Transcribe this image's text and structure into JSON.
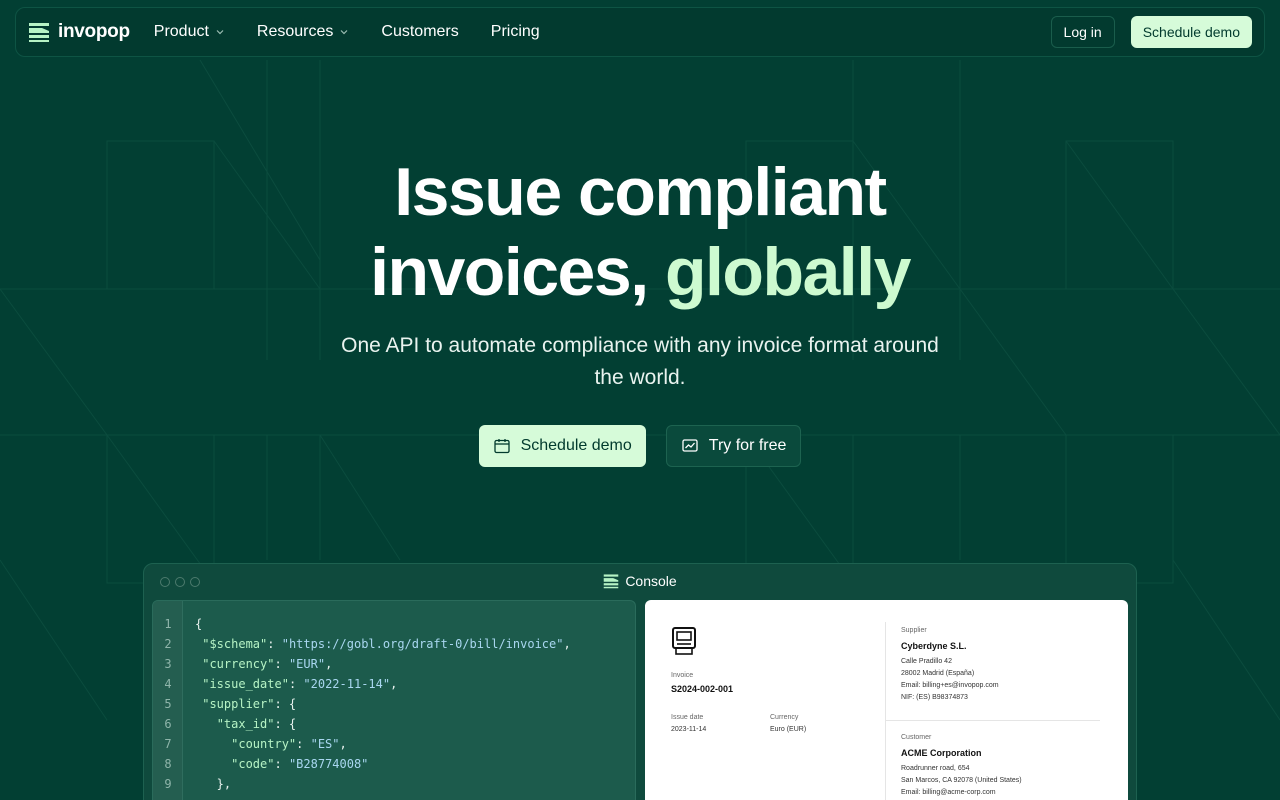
{
  "brand": {
    "name": "invopop"
  },
  "nav": {
    "links": [
      {
        "label": "Product",
        "has_dropdown": true
      },
      {
        "label": "Resources",
        "has_dropdown": true
      },
      {
        "label": "Customers",
        "has_dropdown": false
      },
      {
        "label": "Pricing",
        "has_dropdown": false
      }
    ],
    "login_label": "Log in",
    "demo_label": "Schedule demo"
  },
  "hero": {
    "title_line1": "Issue compliant",
    "title_line2_plain": "invoices, ",
    "title_line2_accent": "globally",
    "subtitle": "One API to automate compliance with any invoice format around the world.",
    "cta_primary": "Schedule demo",
    "cta_secondary": "Try for free"
  },
  "console": {
    "title": "Console",
    "code_lines": [
      {
        "n": "1",
        "text": "{"
      },
      {
        "n": "2",
        "text": " \"$schema\": \"https://gobl.org/draft-0/bill/invoice\","
      },
      {
        "n": "3",
        "text": " \"currency\": \"EUR\","
      },
      {
        "n": "4",
        "text": " \"issue_date\": \"2022-11-14\","
      },
      {
        "n": "5",
        "text": " \"supplier\": {"
      },
      {
        "n": "6",
        "text": "   \"tax_id\": {"
      },
      {
        "n": "7",
        "text": "     \"country\": \"ES\","
      },
      {
        "n": "8",
        "text": "     \"code\": \"B28774008\""
      },
      {
        "n": "9",
        "text": "   },"
      }
    ],
    "invoice": {
      "invoice_label": "Invoice",
      "invoice_number": "S2024-002-001",
      "issue_date_label": "Issue date",
      "issue_date": "2023-11-14",
      "currency_label": "Currency",
      "currency": "Euro (EUR)",
      "supplier_label": "Supplier",
      "supplier_name": "Cyberdyne S.L.",
      "supplier_address1": "Calle Pradillo 42",
      "supplier_address2": "28002 Madrid (España)",
      "supplier_email": "Email: billing+es@invopop.com",
      "supplier_nif": "NIF: (ES) B98374873",
      "customer_label": "Customer",
      "customer_name": "ACME Corporation",
      "customer_address1": "Roadrunner road, 654",
      "customer_address2": "San Marcos, CA 92078 (United States)",
      "customer_email": "Email: billing@acme-corp.com"
    }
  },
  "colors": {
    "background": "#023f33",
    "accent": "#cdfad0",
    "button_light": "#d6fbd9"
  }
}
